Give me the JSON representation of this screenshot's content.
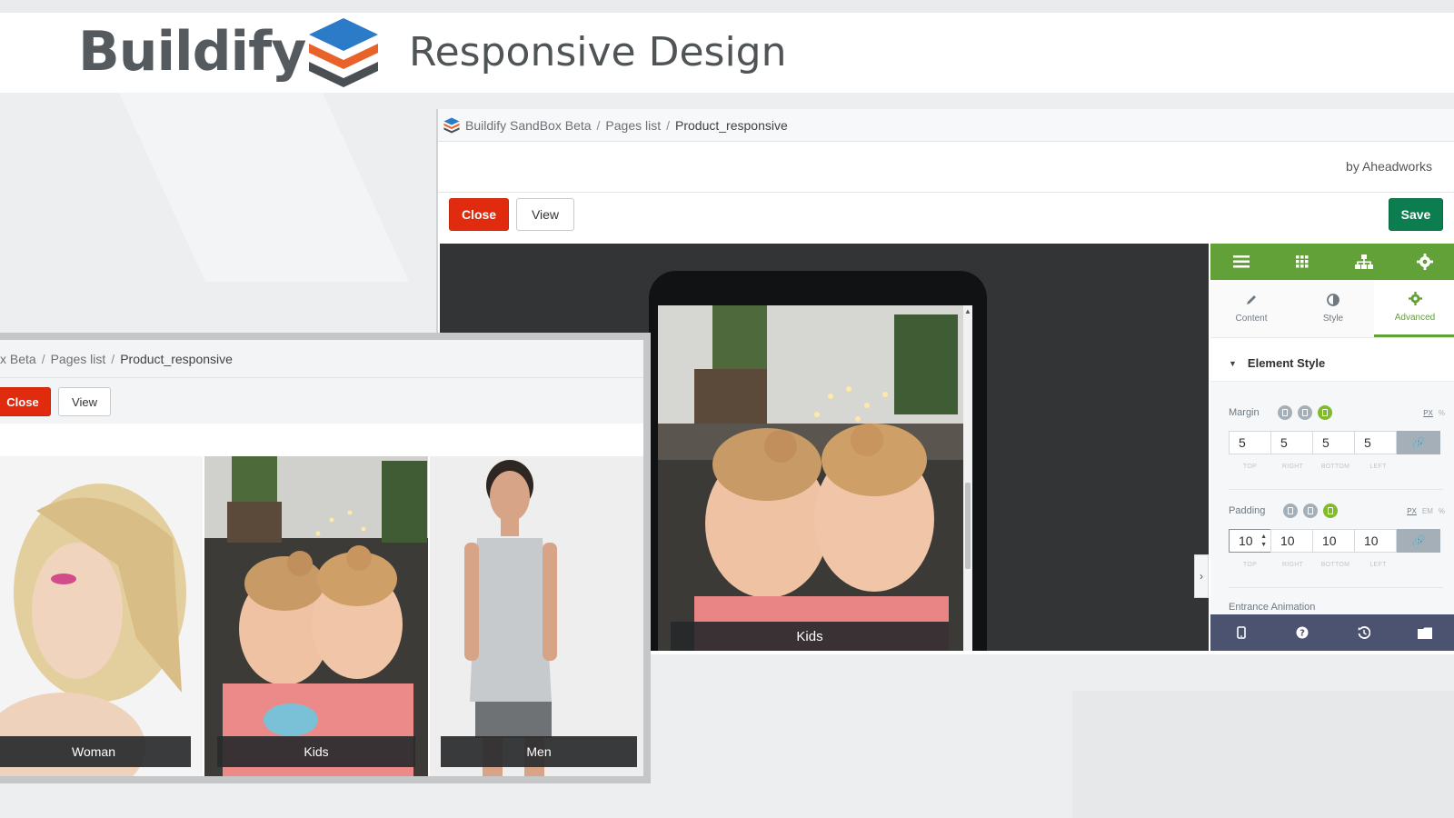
{
  "banner": {
    "brand": "Buildify",
    "subtitle": "Responsive Design",
    "logo_colors": [
      "#2b7bc9",
      "#e8622a",
      "#4a4f54"
    ]
  },
  "main_window": {
    "breadcrumbs": [
      "Buildify SandBox Beta",
      "Pages list",
      "Product_responsive"
    ],
    "byline": "by Aheadworks",
    "buttons": {
      "close": "Close",
      "view": "View",
      "save": "Save"
    },
    "preview_caption": "Kids",
    "panel": {
      "top_icons": [
        "menu-icon",
        "grid-icon",
        "sitemap-icon",
        "settings-icon"
      ],
      "tabs": [
        {
          "label": "Content",
          "icon": "pencil-icon"
        },
        {
          "label": "Style",
          "icon": "contrast-icon"
        },
        {
          "label": "Advanced",
          "icon": "gear-icon"
        }
      ],
      "active_tab": "Advanced",
      "section_title": "Element Style",
      "margin": {
        "label": "Margin",
        "units": [
          "PX",
          "%"
        ],
        "values": [
          "5",
          "5",
          "5",
          "5"
        ],
        "sides": [
          "TOP",
          "RIGHT",
          "BOTTOM",
          "LEFT"
        ]
      },
      "padding": {
        "label": "Padding",
        "units": [
          "PX",
          "EM",
          "%"
        ],
        "values": [
          "10",
          "10",
          "10",
          "10"
        ],
        "sides": [
          "TOP",
          "RIGHT",
          "BOTTOM",
          "LEFT"
        ]
      },
      "next_control": "Entrance Animation",
      "footer_icons": [
        "mobile-icon",
        "help-icon",
        "history-icon",
        "folder-icon"
      ]
    },
    "colors": {
      "accent_green": "#62a138",
      "close_red": "#e02b0e",
      "save_green": "#0b7d4f",
      "footer": "#4c5370"
    }
  },
  "front_window": {
    "breadcrumbs": [
      "x Beta",
      "Pages list",
      "Product_responsive"
    ],
    "buttons": {
      "close": "Close",
      "view": "View"
    },
    "tiles": [
      "Woman",
      "Kids",
      "Men"
    ]
  }
}
